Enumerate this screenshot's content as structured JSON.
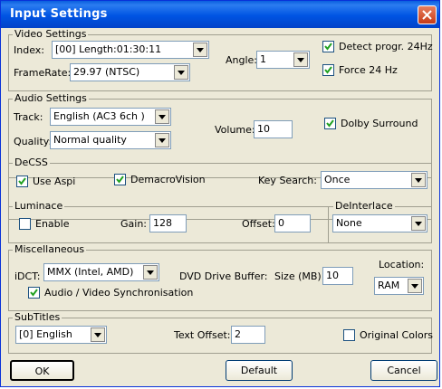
{
  "window": {
    "title": "Input Settings"
  },
  "video": {
    "legend": "Video Settings",
    "index_label": "Index:",
    "index_value": "[00] Length:01:30:11",
    "framerate_label": "FrameRate:",
    "framerate_value": "29.97 (NTSC)",
    "angle_label": "Angle:",
    "angle_value": "1",
    "detect_label": "Detect progr. 24Hz",
    "detect_checked": true,
    "force_label": "Force 24 Hz",
    "force_checked": true
  },
  "audio": {
    "legend": "Audio Settings",
    "track_label": "Track:",
    "track_value": "English (AC3 6ch )",
    "quality_label": "Quality:",
    "quality_value": "Normal quality",
    "volume_label": "Volume:",
    "volume_value": "10",
    "dolby_label": "Dolby Surround",
    "dolby_checked": true
  },
  "decss": {
    "legend": "DeCSS",
    "aspi_label": "Use Aspi",
    "aspi_checked": true,
    "demacro_label": "DemacroVision",
    "demacro_checked": true,
    "keysearch_label": "Key Search:",
    "keysearch_value": "Once"
  },
  "luminance": {
    "legend": "Luminace",
    "enable_label": "Enable",
    "enable_checked": false,
    "gain_label": "Gain:",
    "gain_value": "128",
    "offset_label": "Offset:",
    "offset_value": "0"
  },
  "deinterlace": {
    "legend": "DeInterlace",
    "value": "None"
  },
  "misc": {
    "legend": "Miscellaneous",
    "idct_label": "iDCT:",
    "idct_value": "MMX (Intel, AMD)",
    "buffer_label": "DVD Drive Buffer:",
    "size_label": "Size (MB):",
    "size_value": "10",
    "location_label": "Location:",
    "location_value": "RAM",
    "sync_label": "Audio / Video Synchronisation",
    "sync_checked": true
  },
  "subtitles": {
    "legend": "SubTitles",
    "value": "[0] English",
    "text_offset_label": "Text Offset:",
    "text_offset_value": "2",
    "original_colors_label": "Original Colors",
    "original_colors_checked": false
  },
  "buttons": {
    "ok": "OK",
    "default": "Default",
    "cancel": "Cancel"
  },
  "icons": {
    "close": "close-icon",
    "dropdown": "chevron-down-icon",
    "check": "checkmark-icon"
  }
}
